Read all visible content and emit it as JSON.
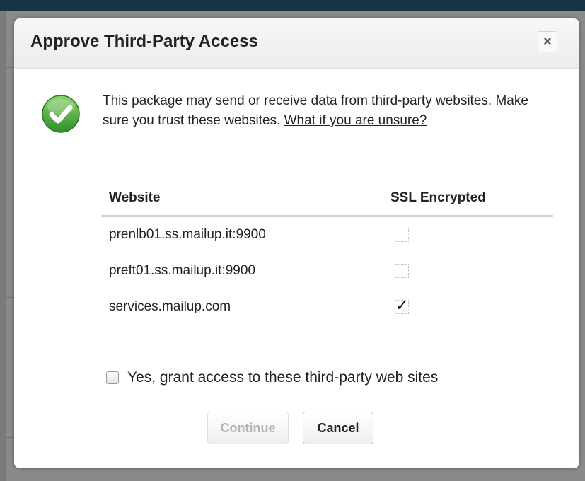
{
  "dialog": {
    "title": "Approve Third-Party Access",
    "close_label": "×",
    "intro_text": "This package may send or receive data from third-party websites. Make sure you trust these websites. ",
    "intro_link": "What if you are unsure?"
  },
  "table": {
    "headers": {
      "website": "Website",
      "ssl": "SSL Encrypted"
    },
    "rows": [
      {
        "website": "prenlb01.ss.mailup.it:9900",
        "ssl": false
      },
      {
        "website": "preft01.ss.mailup.it:9900",
        "ssl": false
      },
      {
        "website": "services.mailup.com",
        "ssl": true,
        "ssl_mark": "✓"
      }
    ]
  },
  "consent": {
    "checked": false,
    "label": "Yes, grant access to these third-party web sites"
  },
  "buttons": {
    "continue_label": "Continue",
    "cancel_label": "Cancel"
  },
  "colors": {
    "success_green": "#4cae3d",
    "header_bar": "#173544"
  }
}
